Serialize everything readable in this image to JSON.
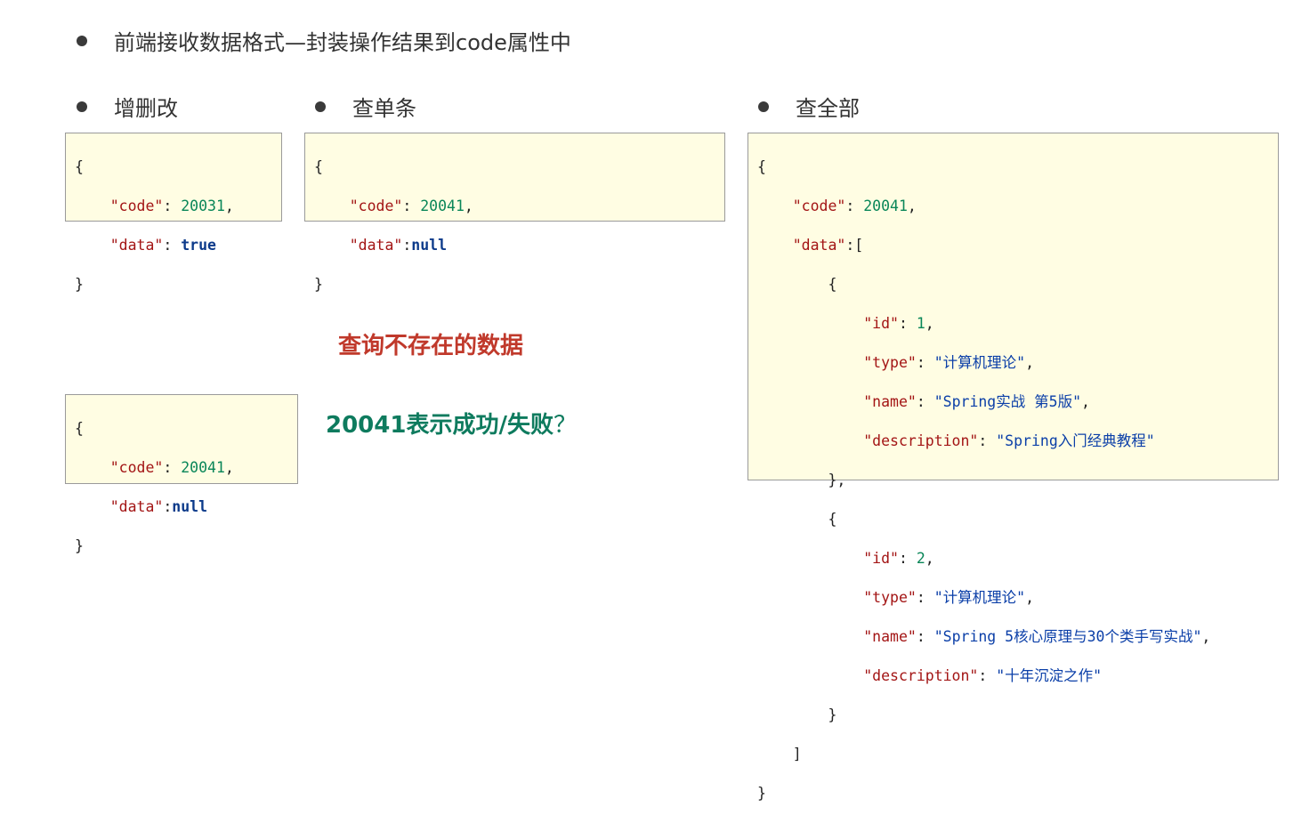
{
  "heading": "前端接收数据格式—封装操作结果到code属性中",
  "sections": {
    "cud": "增删改",
    "get_one": "查单条",
    "get_all": "查全部"
  },
  "boxes": {
    "cud": {
      "code_key": "\"code\"",
      "code_val": "20031",
      "data_key": "\"data\"",
      "data_val": "true"
    },
    "get_one": {
      "code_key": "\"code\"",
      "code_val": "20041",
      "data_key": "\"data\"",
      "data_val": "null"
    },
    "not_found": {
      "code_key": "\"code\"",
      "code_val": "20041",
      "data_key": "\"data\"",
      "data_val": "null"
    },
    "get_all": {
      "code_key": "\"code\"",
      "code_val": "20041",
      "data_key": "\"data\"",
      "items": [
        {
          "id_key": "\"id\"",
          "id": "1",
          "type_key": "\"type\"",
          "type": "\"计算机理论\"",
          "name_key": "\"name\"",
          "name": "\"Spring实战 第5版\"",
          "desc_key": "\"description\"",
          "description": "\"Spring入门经典教程\""
        },
        {
          "id_key": "\"id\"",
          "id": "2",
          "type_key": "\"type\"",
          "type": "\"计算机理论\"",
          "name_key": "\"name\"",
          "name": "\"Spring 5核心原理与30个类手写实战\"",
          "desc_key": "\"description\"",
          "description": "\"十年沉淀之作\""
        }
      ]
    }
  },
  "notes": {
    "query_missing": "查询不存在的数据",
    "question_main": "20041表示成功/失败",
    "question_mark": "？"
  },
  "colors": {
    "key": "#a31515",
    "number": "#098658",
    "string": "#0b3fa8",
    "keyword": "#0c3a8a",
    "box_bg": "#fffde3",
    "note_red": "#c0392b",
    "note_green": "#0e7b5e"
  }
}
